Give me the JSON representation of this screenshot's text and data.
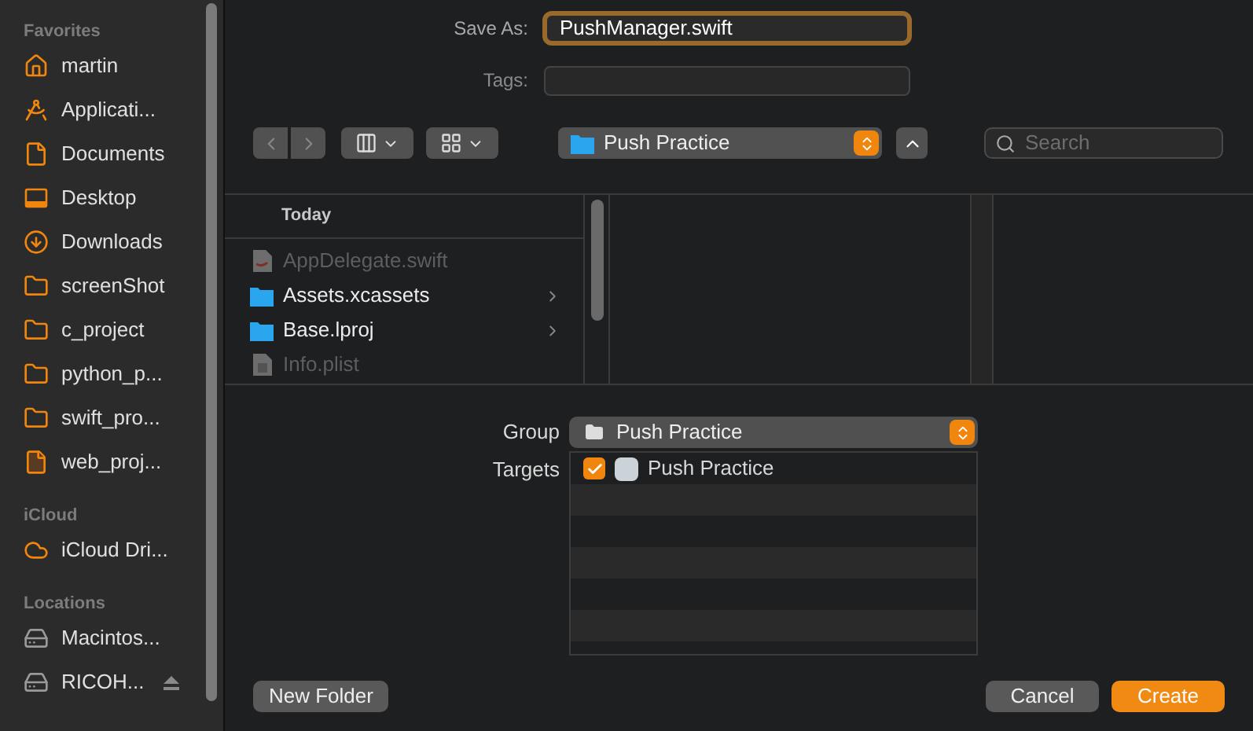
{
  "sidebar": {
    "sections": [
      {
        "title": "Favorites",
        "items": [
          {
            "label": "martin",
            "kind": "home"
          },
          {
            "label": "Applicati...",
            "kind": "apps"
          },
          {
            "label": "Documents",
            "kind": "document"
          },
          {
            "label": "Desktop",
            "kind": "desktop"
          },
          {
            "label": "Downloads",
            "kind": "download"
          },
          {
            "label": "screenShot",
            "kind": "folder"
          },
          {
            "label": "c_project",
            "kind": "folder"
          },
          {
            "label": "python_p...",
            "kind": "folder"
          },
          {
            "label": "swift_pro...",
            "kind": "folder"
          },
          {
            "label": "web_proj...",
            "kind": "file"
          }
        ]
      },
      {
        "title": "iCloud",
        "items": [
          {
            "label": "iCloud Dri...",
            "kind": "cloud"
          }
        ]
      },
      {
        "title": "Locations",
        "items": [
          {
            "label": "Macintos...",
            "kind": "drive",
            "ejectable": false
          },
          {
            "label": "RICOH...",
            "kind": "drive",
            "ejectable": true
          }
        ]
      }
    ]
  },
  "save_as": {
    "label": "Save As:",
    "value": "PushManager.swift"
  },
  "tags": {
    "label": "Tags:"
  },
  "toolbar": {
    "location": "Push Practice",
    "search": {
      "placeholder": "Search"
    }
  },
  "browser": {
    "header": "Today",
    "files": [
      {
        "name": "AppDelegate.swift",
        "kind": "swift",
        "disabled": true
      },
      {
        "name": "Assets.xcassets",
        "kind": "folder",
        "disabled": false
      },
      {
        "name": "Base.lproj",
        "kind": "folder",
        "disabled": false
      },
      {
        "name": "Info.plist",
        "kind": "plist",
        "disabled": true
      }
    ]
  },
  "group": {
    "label": "Group",
    "value": "Push Practice"
  },
  "targets": {
    "label": "Targets",
    "items": [
      {
        "name": "Push Practice",
        "checked": true
      }
    ]
  },
  "buttons": {
    "new_folder": "New Folder",
    "cancel": "Cancel",
    "create": "Create"
  }
}
